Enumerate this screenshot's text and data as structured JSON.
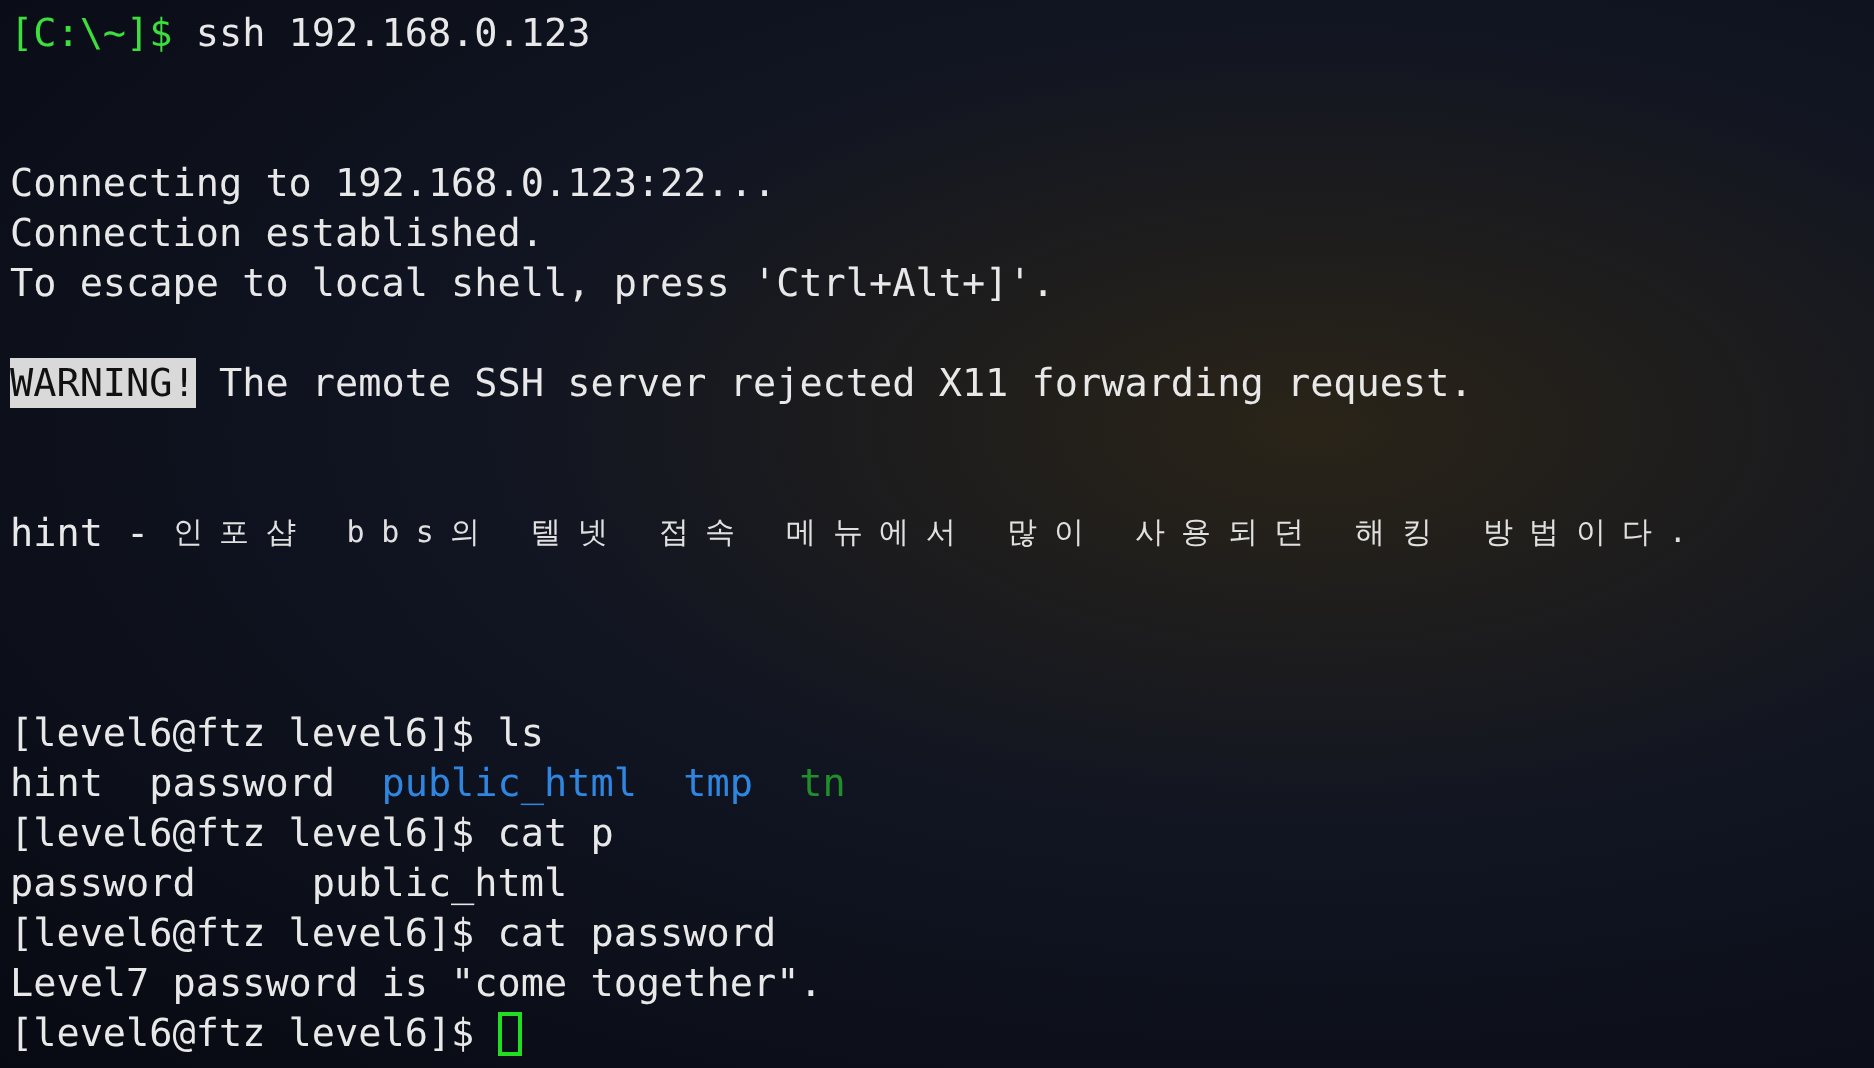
{
  "terminal": {
    "lines": [
      {
        "segments": [
          {
            "kind": "prompt",
            "text": "[C:\\~]$ "
          },
          {
            "kind": "text",
            "text": "ssh 192.168.0.123"
          }
        ]
      },
      {
        "blank": true
      },
      {
        "blank": true
      },
      {
        "segments": [
          {
            "kind": "text",
            "text": "Connecting to 192.168.0.123:22..."
          }
        ]
      },
      {
        "segments": [
          {
            "kind": "text",
            "text": "Connection established."
          }
        ]
      },
      {
        "segments": [
          {
            "kind": "text",
            "text": "To escape to local shell, press 'Ctrl+Alt+]'."
          }
        ]
      },
      {
        "blank": true
      },
      {
        "segments": [
          {
            "kind": "highlight",
            "text": "WARNING!"
          },
          {
            "kind": "text",
            "text": " The remote SSH server rejected X11 forwarding request."
          }
        ]
      },
      {
        "blank": true
      },
      {
        "blank": true
      },
      {
        "segments": [
          {
            "kind": "text",
            "text": "hint - "
          },
          {
            "kind": "wide",
            "text": "인포샵 bbs의 텔넷 접속 메뉴에서 많이 사용되던 해킹 방법이다."
          }
        ]
      },
      {
        "blank": true
      },
      {
        "blank": true
      },
      {
        "blank": true
      },
      {
        "segments": [
          {
            "kind": "text",
            "text": "[level6@ftz level6]$ ls"
          }
        ]
      },
      {
        "segments": [
          {
            "kind": "text",
            "text": "hint  password"
          },
          {
            "kind": "dir",
            "text": "public_html",
            "pad": true
          },
          {
            "kind": "dir",
            "text": "tmp",
            "pad": true
          },
          {
            "kind": "exec",
            "text": "tn",
            "pad": true
          }
        ]
      },
      {
        "segments": [
          {
            "kind": "text",
            "text": "[level6@ftz level6]$ cat p"
          }
        ]
      },
      {
        "segments": [
          {
            "kind": "text",
            "text": "password     public_html"
          }
        ]
      },
      {
        "segments": [
          {
            "kind": "text",
            "text": "[level6@ftz level6]$ cat password"
          }
        ]
      },
      {
        "segments": [
          {
            "kind": "text",
            "text": "Level7 password is \"come together\"."
          }
        ]
      },
      {
        "segments": [
          {
            "kind": "text",
            "text": "[level6@ftz level6]$ "
          }
        ],
        "cursor": true
      }
    ]
  }
}
